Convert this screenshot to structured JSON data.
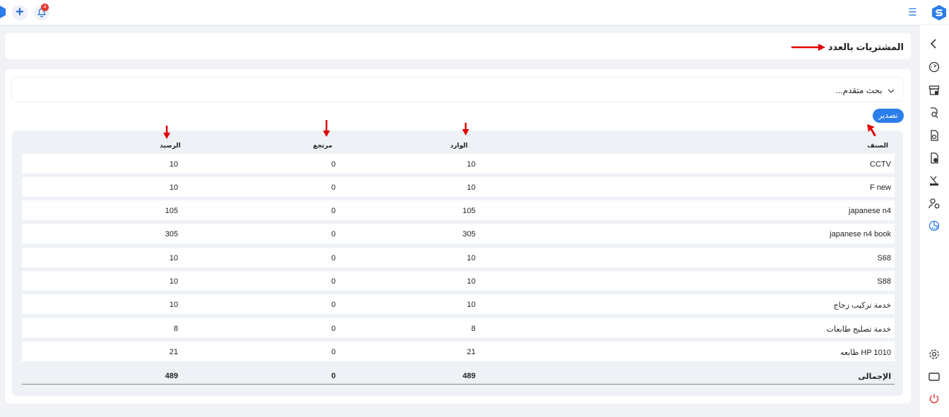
{
  "page_title": "المشتريات بالعدد",
  "search": {
    "advanced_label": "بحث متقدم..."
  },
  "export_label": "تصدير",
  "notifications": {
    "count": "4"
  },
  "table": {
    "headers": {
      "item": "الصنف",
      "incoming": "الوارد",
      "returned": "مرتجع",
      "balance": "الرصيد"
    },
    "rows": [
      {
        "item": "CCTV",
        "incoming": "10",
        "returned": "0",
        "balance": "10"
      },
      {
        "item": "F new",
        "incoming": "10",
        "returned": "0",
        "balance": "10"
      },
      {
        "item": "japanese n4",
        "incoming": "105",
        "returned": "0",
        "balance": "105"
      },
      {
        "item": "japanese n4 book",
        "incoming": "305",
        "returned": "0",
        "balance": "305"
      },
      {
        "item": "S68",
        "incoming": "10",
        "returned": "0",
        "balance": "10"
      },
      {
        "item": "S88",
        "incoming": "10",
        "returned": "0",
        "balance": "10"
      },
      {
        "item": "خدمة تركيب زجاج",
        "incoming": "10",
        "returned": "0",
        "balance": "10"
      },
      {
        "item": "خدمة تصليح طابعات",
        "incoming": "8",
        "returned": "0",
        "balance": "8"
      },
      {
        "item": "طابعه HP 1010",
        "incoming": "21",
        "returned": "0",
        "balance": "21"
      }
    ],
    "total": {
      "label": "الإجمالى",
      "incoming": "489",
      "returned": "0",
      "balance": "489"
    }
  },
  "sidebar_icons": [
    "chevron-left-icon",
    "dashboard-icon",
    "store-icon",
    "search-doc-icon",
    "money-doc-icon",
    "invoice-icon",
    "inventory-icon",
    "users-icon",
    "report-icon",
    "settings-icon",
    "window-icon",
    "power-icon"
  ],
  "colors": {
    "accent": "#2b7de9",
    "annotation_arrow": "#e00000",
    "power": "#e53935"
  }
}
